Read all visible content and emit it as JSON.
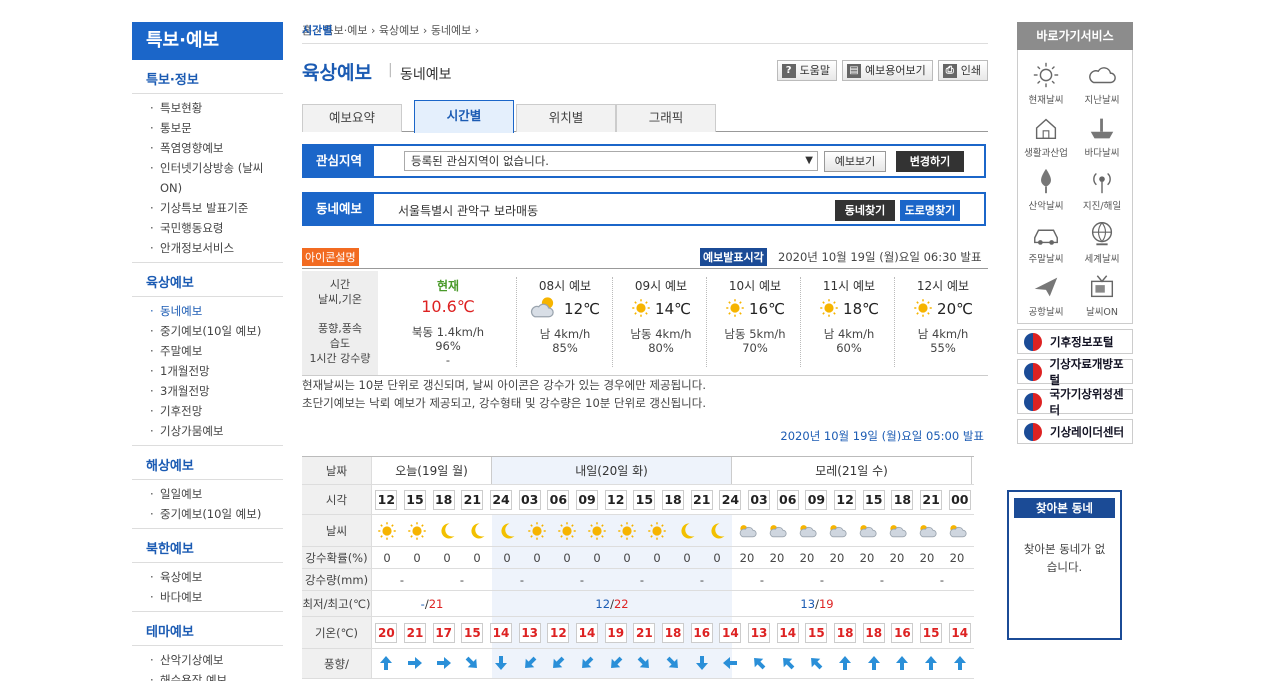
{
  "leftnav": {
    "header": "특보·예보",
    "sections": [
      {
        "title": "특보·정보",
        "items": [
          "특보현황",
          "통보문",
          "폭염영향예보",
          "인터넷기상방송 (날씨ON)",
          "기상특보 발표기준",
          "국민행동요령",
          "안개정보서비스"
        ]
      },
      {
        "title": "육상예보",
        "items": [
          "동네예보",
          "중기예보(10일 예보)",
          "주말예보",
          "1개월전망",
          "3개월전망",
          "기후전망",
          "기상가뭄예보"
        ]
      },
      {
        "title": "해상예보",
        "items": [
          "일일예보",
          "중기예보(10일 예보)"
        ]
      },
      {
        "title": "북한예보",
        "items": [
          "육상예보",
          "바다예보"
        ]
      },
      {
        "title": "테마예보",
        "items": [
          "산악기상예보",
          "해수욕장 예보",
          "지역별기상정보"
        ]
      }
    ]
  },
  "breadcrumb": [
    "홈",
    "특보·예보",
    "육상예보",
    "동네예보",
    "시간별"
  ],
  "title": "육상예보",
  "subtitle": "동네예보",
  "toolbar": {
    "help": "도움말",
    "terms": "예보용어보기",
    "print": "인쇄"
  },
  "tabs": [
    "예보요약",
    "시간별",
    "위치별",
    "그래픽"
  ],
  "interest": {
    "label": "관심지역",
    "select": "등록된 관심지역이 없습니다.",
    "view": "예보보기",
    "change": "변경하기"
  },
  "neighborhood": {
    "label": "동네예보",
    "address": "서울특별시 관악구 보라매동",
    "find": "동네찾기",
    "road": "도로명찾기"
  },
  "info": {
    "icon_link": "아이콘설명",
    "pub_tag": "예보발표시각",
    "pub_time": "2020년 10월 19일 (월)요일 06:30 발표"
  },
  "current": {
    "labels": [
      "시간",
      "날씨,기온",
      "풍향,풍속",
      "습도",
      "1시간 강수량"
    ],
    "now": {
      "head": "현재",
      "temp": "10.6℃",
      "wind": "북동 1.4km/h",
      "humidity": "96%",
      "rain": "-"
    },
    "forecasts": [
      {
        "head": "08시 예보",
        "temp": "12℃",
        "wind": "남 4km/h",
        "humidity": "85%",
        "icon": "partly-cloudy"
      },
      {
        "head": "09시 예보",
        "temp": "14℃",
        "wind": "남동 4km/h",
        "humidity": "80%",
        "icon": "sun"
      },
      {
        "head": "10시 예보",
        "temp": "16℃",
        "wind": "남동 5km/h",
        "humidity": "70%",
        "icon": "sun"
      },
      {
        "head": "11시 예보",
        "temp": "18℃",
        "wind": "남 4km/h",
        "humidity": "60%",
        "icon": "sun"
      },
      {
        "head": "12시 예보",
        "temp": "20℃",
        "wind": "남 4km/h",
        "humidity": "55%",
        "icon": "sun"
      }
    ]
  },
  "notes": [
    "현재날씨는 10분 단위로 갱신되며, 날씨 아이콘은 강수가 있는 경우에만 제공됩니다.",
    "초단기예보는 낙뢰 예보가 제공되고, 강수형태 및 강수량은 10분 단위로 갱신됩니다."
  ],
  "grid_pub": "2020년 10월 19일 (월)요일 05:00 발표",
  "grid": {
    "labels": {
      "date": "날짜",
      "time": "시각",
      "weather": "날씨",
      "pop": "강수확률(%)",
      "rain": "강수량(mm)",
      "minmax": "최저/최고(℃)",
      "temp": "기온(℃)",
      "wind": "풍향/"
    },
    "days": [
      "오늘(19일 월)",
      "내일(20일 화)",
      "모레(21일 수)"
    ],
    "hours": [
      "12",
      "15",
      "18",
      "21",
      "24",
      "03",
      "06",
      "09",
      "12",
      "15",
      "18",
      "21",
      "24",
      "03",
      "06",
      "09",
      "12",
      "15",
      "18",
      "21",
      "00"
    ],
    "weather": [
      "sun",
      "sun",
      "moon",
      "moon",
      "moon",
      "sun",
      "sun",
      "sun",
      "sun",
      "sun",
      "moon",
      "moon",
      "cloud",
      "cloud",
      "cloud",
      "cloud",
      "cloud",
      "cloud",
      "cloud",
      "cloud"
    ],
    "pop": [
      "0",
      "0",
      "0",
      "0",
      "0",
      "0",
      "0",
      "0",
      "0",
      "0",
      "0",
      "0",
      "20",
      "20",
      "20",
      "20",
      "20",
      "20",
      "20",
      "20"
    ],
    "rain": [
      "-",
      "-",
      "-",
      "-",
      "-",
      "-",
      "-",
      "-",
      "-",
      "-"
    ],
    "minmax": [
      {
        "min": "-",
        "max": "21"
      },
      {
        "min": "12",
        "max": "22"
      },
      {
        "min": "13",
        "max": "19"
      }
    ],
    "temps": [
      "20",
      "21",
      "17",
      "15",
      "14",
      "13",
      "12",
      "14",
      "19",
      "21",
      "18",
      "16",
      "14",
      "13",
      "14",
      "15",
      "18",
      "18",
      "16",
      "15",
      "14"
    ],
    "winds": [
      "N",
      "E",
      "E",
      "SE",
      "S",
      "SW",
      "SW",
      "SW",
      "SW",
      "SE",
      "SE",
      "S",
      "W",
      "NW",
      "NW",
      "NW",
      "N",
      "N",
      "N",
      "N",
      "N"
    ]
  },
  "right": {
    "quick_title": "바로가기서비스",
    "quick_items": [
      {
        "label": "현재날씨",
        "icon": "sun-icon"
      },
      {
        "label": "지난날씨",
        "icon": "cloud-icon"
      },
      {
        "label": "생활과산업",
        "icon": "house-icon"
      },
      {
        "label": "바다날씨",
        "icon": "ship-icon"
      },
      {
        "label": "산악날씨",
        "icon": "tree-icon"
      },
      {
        "label": "지진/해일",
        "icon": "signal-icon"
      },
      {
        "label": "주말날씨",
        "icon": "car-icon"
      },
      {
        "label": "세계날씨",
        "icon": "globe-icon"
      },
      {
        "label": "공항날씨",
        "icon": "plane-icon"
      },
      {
        "label": "날씨ON",
        "icon": "tv-icon"
      }
    ],
    "portals": [
      "기후정보포털",
      "기상자료개방포털",
      "국가기상위성센터",
      "기상레이더센터"
    ],
    "visited_title": "찾아본 동네",
    "visited_body": "찾아본 동네가 없습니다."
  }
}
